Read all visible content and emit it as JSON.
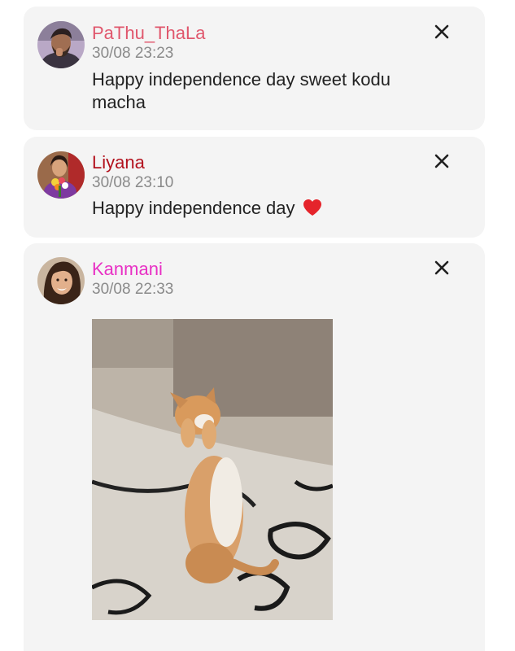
{
  "posts": [
    {
      "username": "PaThu_ThaLa",
      "username_color": "#e0566c",
      "timestamp": "30/08 23:23",
      "message": "Happy independence day sweet kodu macha",
      "avatar_icon": "avatar-man-bearded",
      "close_icon": "close-icon"
    },
    {
      "username": "Liyana",
      "username_color": "#b3121e",
      "timestamp": "30/08 23:10",
      "message": "Happy independence day",
      "message_emoji": "heart-icon",
      "avatar_icon": "avatar-woman-flowers",
      "close_icon": "close-icon"
    },
    {
      "username": "Kanmani",
      "username_color": "#e830c4",
      "timestamp": "30/08 22:33",
      "message": "",
      "attachment": "gif-image-kitten-standing",
      "avatar_icon": "avatar-woman-smiling",
      "close_icon": "close-icon"
    }
  ]
}
